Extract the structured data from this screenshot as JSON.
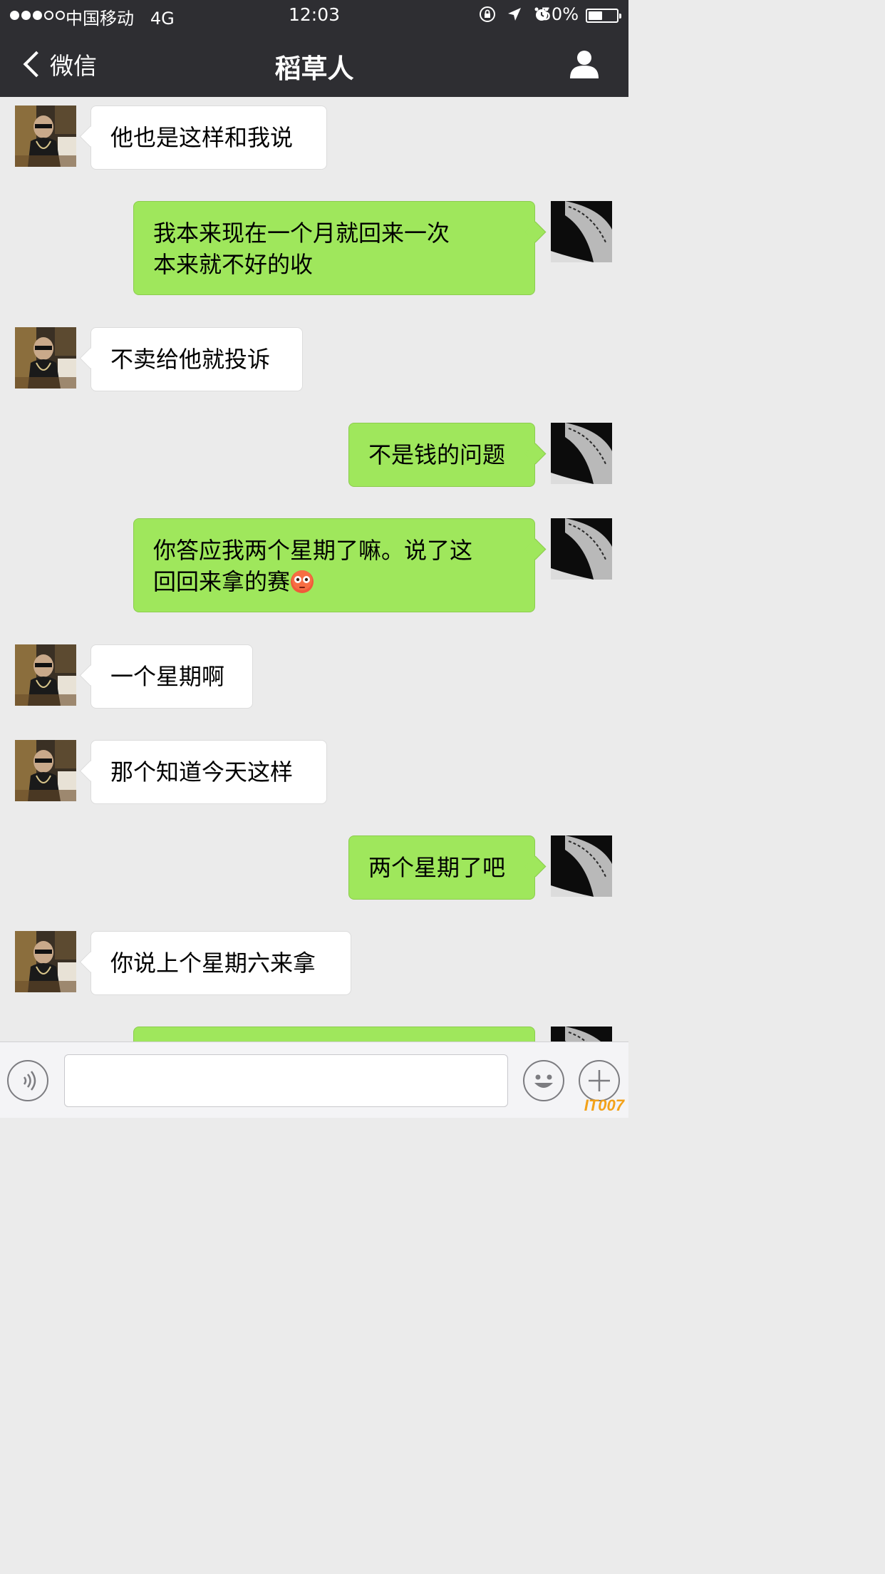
{
  "status_bar": {
    "carrier": "中国移动",
    "network": "4G",
    "time": "12:03",
    "battery_text": "50%",
    "battery_level": 0.5,
    "signal_strength": 3,
    "signal_max": 5,
    "icons": [
      "rotation-lock-icon",
      "location-arrow-icon",
      "alarm-icon"
    ]
  },
  "nav": {
    "back_label": "微信",
    "title": "稻草人",
    "right_icon": "person-icon"
  },
  "messages": [
    {
      "direction": "in",
      "text": "他也是这样和我说"
    },
    {
      "direction": "out",
      "text": "我本来现在一个月就回来一次\n本来就不好的收"
    },
    {
      "direction": "in",
      "text": "不卖给他就投诉"
    },
    {
      "direction": "out",
      "text": "不是钱的问题"
    },
    {
      "direction": "out",
      "text": "你答应我两个星期了嘛。说了这\n回回来拿的赛",
      "trailing_emoji": "flushed-face-emoji"
    },
    {
      "direction": "in",
      "text": "一个星期啊"
    },
    {
      "direction": "in",
      "text": "那个知道今天这样"
    },
    {
      "direction": "out",
      "text": "两个星期了吧"
    },
    {
      "direction": "in",
      "text": "你说上个星期六来拿"
    },
    {
      "direction": "out",
      "text": ""
    }
  ],
  "input_bar": {
    "voice_icon": "voice-icon",
    "emoji_icon": "smiley-icon",
    "plus_icon": "plus-icon"
  },
  "watermark": "IT007",
  "colors": {
    "nav_bg": "#2e2e32",
    "chat_bg": "#ebebeb",
    "outgoing_bubble": "#9fe75c",
    "incoming_bubble": "#ffffff"
  }
}
